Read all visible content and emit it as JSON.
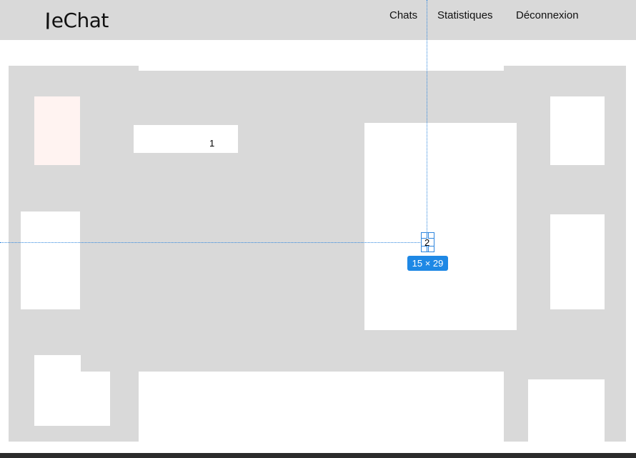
{
  "header": {
    "logo_text": "eChat",
    "logo_prefix": "\\",
    "nav": {
      "chats": "Chats",
      "stats": "Statistiques",
      "logout": "Déconnexion"
    }
  },
  "floor": {
    "table_1_label": "1",
    "table_2_label": "2"
  },
  "selection": {
    "size_label": "15 × 29"
  },
  "colors": {
    "header_bg": "#d9d9d9",
    "floor_grey": "#d9d9d9",
    "accent_blue": "#1e88e5",
    "pink_tile": "#fff3f1"
  }
}
